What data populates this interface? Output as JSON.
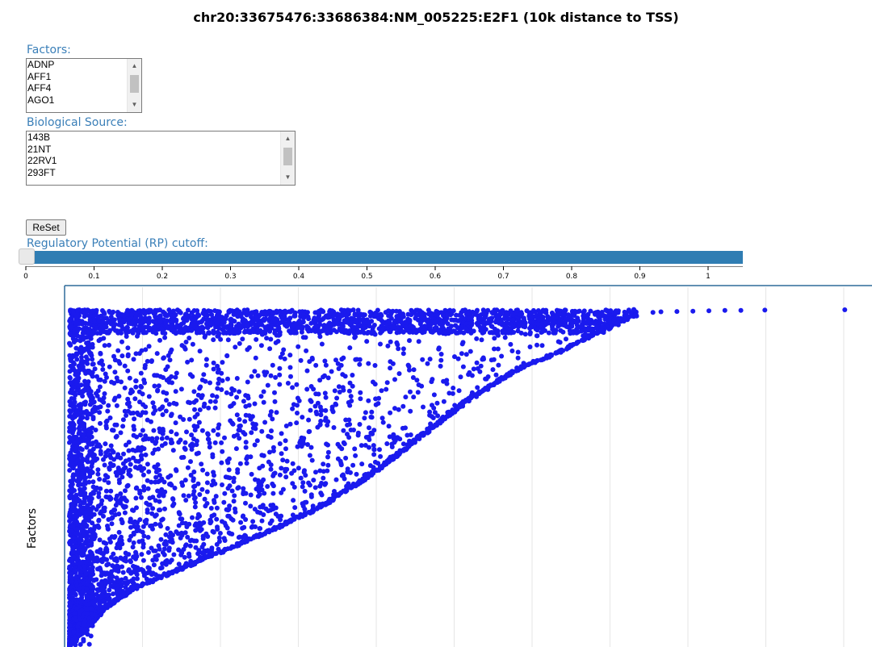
{
  "page": {
    "title": "chr20:33675476:33686384:NM_005225:E2F1 (10k distance to TSS)"
  },
  "factors_filter": {
    "label": "Factors:",
    "options": [
      "ADNP",
      "AFF1",
      "AFF4",
      "AGO1"
    ]
  },
  "source_filter": {
    "label": "Biological Source:",
    "options": [
      "143B",
      "21NT",
      "22RV1",
      "293FT"
    ]
  },
  "reset_button": {
    "label": "ReSet"
  },
  "rp_cutoff": {
    "label": "Regulatory Potential (RP) cutoff:",
    "value": 0,
    "ticks": [
      "0",
      "0.1",
      "0.2",
      "0.3",
      "0.4",
      "0.5",
      "0.6",
      "0.7",
      "0.8",
      "0.9",
      "1"
    ]
  },
  "colors": {
    "points": "#1a1aee",
    "slider_track": "#2f7db3",
    "label": "#3a7fb8"
  },
  "chart_data": {
    "type": "scatter",
    "ylabel": "Factors",
    "xlabel": "",
    "xlim": [
      0,
      1
    ],
    "grid": "vertical",
    "frontier": [
      [
        0.0,
        1.0
      ],
      [
        0.02,
        0.95
      ],
      [
        0.05,
        0.88
      ],
      [
        0.08,
        0.83
      ],
      [
        0.12,
        0.79
      ],
      [
        0.18,
        0.73
      ],
      [
        0.25,
        0.66
      ],
      [
        0.32,
        0.58
      ],
      [
        0.38,
        0.49
      ],
      [
        0.44,
        0.38
      ],
      [
        0.5,
        0.27
      ],
      [
        0.56,
        0.18
      ],
      [
        0.62,
        0.12
      ],
      [
        0.66,
        0.07
      ],
      [
        0.69,
        0.035
      ],
      [
        0.71,
        0.015
      ]
    ],
    "outliers": [
      [
        0.73,
        0.008
      ],
      [
        0.74,
        0.006
      ],
      [
        0.76,
        0.005
      ],
      [
        0.78,
        0.004
      ],
      [
        0.8,
        0.003
      ],
      [
        0.82,
        0.002
      ],
      [
        0.84,
        0.002
      ],
      [
        0.87,
        0.001
      ],
      [
        0.97,
        0.0
      ]
    ]
  }
}
